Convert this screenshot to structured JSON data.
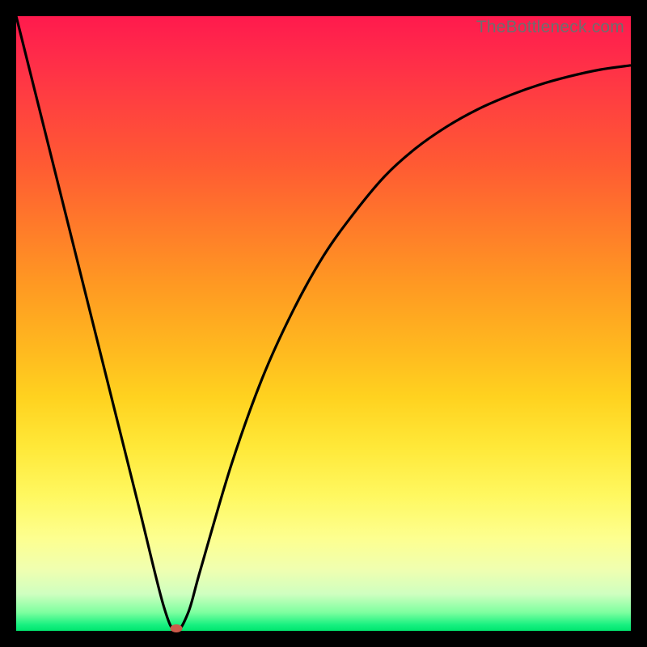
{
  "watermark": "TheBottleneck.com",
  "chart_data": {
    "type": "line",
    "title": "",
    "xlabel": "",
    "ylabel": "",
    "xlim": [
      0,
      100
    ],
    "ylim": [
      0,
      100
    ],
    "x": [
      0,
      5,
      10,
      15,
      20,
      24,
      26,
      28,
      30,
      35,
      40,
      45,
      50,
      55,
      60,
      65,
      70,
      75,
      80,
      85,
      90,
      95,
      100
    ],
    "values": [
      100,
      80,
      60,
      40,
      20,
      4,
      0,
      3,
      10,
      27,
      41,
      52,
      61,
      68,
      74,
      78.5,
      82,
      84.8,
      87,
      88.8,
      90.2,
      91.3,
      92
    ],
    "minimum_marker": {
      "x": 26,
      "y": 0
    }
  },
  "colors": {
    "curve": "#000000",
    "marker": "#cc5a4a",
    "frame": "#000000"
  }
}
